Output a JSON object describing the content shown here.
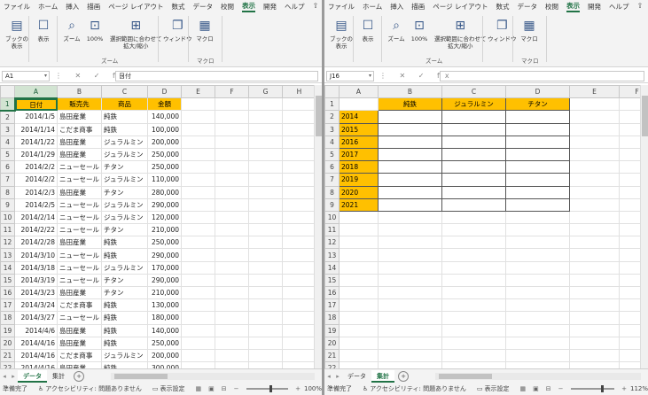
{
  "left": {
    "menu": [
      "ファイル",
      "ホーム",
      "挿入",
      "描画",
      "ページ レイアウト",
      "数式",
      "データ",
      "校閲",
      "表示",
      "開発",
      "ヘルプ"
    ],
    "active_menu": "表示",
    "ribbon": {
      "book_view": "ブックの\n表示",
      "show": "表示",
      "zoom": "ズーム",
      "zoom100": "100%",
      "zoom_sel": "選択範囲に合わせて\n拡大/縮小",
      "window": "ウィンドウ",
      "macro": "マクロ",
      "group_zoom": "ズーム",
      "group_macro": "マクロ"
    },
    "namebox": "A1",
    "formula": "日付",
    "columns": [
      "A",
      "B",
      "C",
      "D",
      "E",
      "F",
      "G",
      "H"
    ],
    "header_row": [
      "日付",
      "販売先",
      "商品",
      "金額"
    ],
    "rows": [
      [
        "2014/1/5",
        "島田産業",
        "純鉄",
        "140,000"
      ],
      [
        "2014/1/14",
        "こだま商事",
        "純鉄",
        "100,000"
      ],
      [
        "2014/1/22",
        "島田産業",
        "ジュラルミン",
        "200,000"
      ],
      [
        "2014/1/29",
        "島田産業",
        "ジュラルミン",
        "250,000"
      ],
      [
        "2014/2/2",
        "ニューセール",
        "チタン",
        "250,000"
      ],
      [
        "2014/2/2",
        "ニューセール",
        "ジュラルミン",
        "110,000"
      ],
      [
        "2014/2/3",
        "島田産業",
        "チタン",
        "280,000"
      ],
      [
        "2014/2/5",
        "ニューセール",
        "ジュラルミン",
        "290,000"
      ],
      [
        "2014/2/14",
        "ニューセール",
        "ジュラルミン",
        "120,000"
      ],
      [
        "2014/2/22",
        "ニューセール",
        "チタン",
        "210,000"
      ],
      [
        "2014/2/28",
        "島田産業",
        "純鉄",
        "250,000"
      ],
      [
        "2014/3/10",
        "ニューセール",
        "純鉄",
        "290,000"
      ],
      [
        "2014/3/18",
        "ニューセール",
        "ジュラルミン",
        "170,000"
      ],
      [
        "2014/3/19",
        "ニューセール",
        "チタン",
        "290,000"
      ],
      [
        "2014/3/23",
        "島田産業",
        "チタン",
        "210,000"
      ],
      [
        "2014/3/24",
        "こだま商事",
        "純鉄",
        "130,000"
      ],
      [
        "2014/3/27",
        "ニューセール",
        "純鉄",
        "180,000"
      ],
      [
        "2014/4/6",
        "島田産業",
        "純鉄",
        "140,000"
      ],
      [
        "2014/4/16",
        "島田産業",
        "純鉄",
        "250,000"
      ],
      [
        "2014/4/16",
        "こだま商事",
        "ジュラルミン",
        "200,000"
      ],
      [
        "2014/4/16",
        "島田産業",
        "純鉄",
        "300,000"
      ],
      [
        "2014/4/25",
        "島田産業",
        "純鉄",
        "120,000"
      ],
      [
        "2014/5/3",
        "島田産業",
        "チタン",
        "260,000"
      ],
      [
        "2014/5/12",
        "こだま商事",
        "純鉄",
        "220,000"
      ]
    ],
    "tabs": [
      "データ",
      "集計"
    ],
    "active_tab": "データ",
    "status_ready": "準備完了",
    "status_access": "アクセシビリティ: 問題ありません",
    "status_display": "表示設定",
    "zoom_level": "100%"
  },
  "right": {
    "menu": [
      "ファイル",
      "ホーム",
      "挿入",
      "描画",
      "ページ レイアウト",
      "数式",
      "データ",
      "校閲",
      "表示",
      "開発",
      "ヘルプ"
    ],
    "active_menu": "表示",
    "ribbon": {
      "book_view": "ブックの\n表示",
      "show": "表示",
      "zoom": "ズーム",
      "zoom100": "100%",
      "zoom_sel": "選択範囲に合わせて\n拡大/縮小",
      "window": "ウィンドウ",
      "macro": "マクロ",
      "group_zoom": "ズーム",
      "group_macro": "マクロ"
    },
    "namebox": "J16",
    "formula": "",
    "columns": [
      "A",
      "B",
      "C",
      "D",
      "E",
      "F"
    ],
    "header_row": [
      "",
      "純鉄",
      "ジュラルミン",
      "チタン"
    ],
    "years": [
      "2014",
      "2015",
      "2016",
      "2017",
      "2018",
      "2019",
      "2020",
      "2021"
    ],
    "tabs": [
      "データ",
      "集計"
    ],
    "active_tab": "集計",
    "status_ready": "準備完了",
    "status_access": "アクセシビリティ: 問題ありません",
    "status_display": "表示設定",
    "zoom_level": "112%"
  },
  "colors": {
    "accent": "#217346",
    "header_fill": "#ffc000"
  }
}
